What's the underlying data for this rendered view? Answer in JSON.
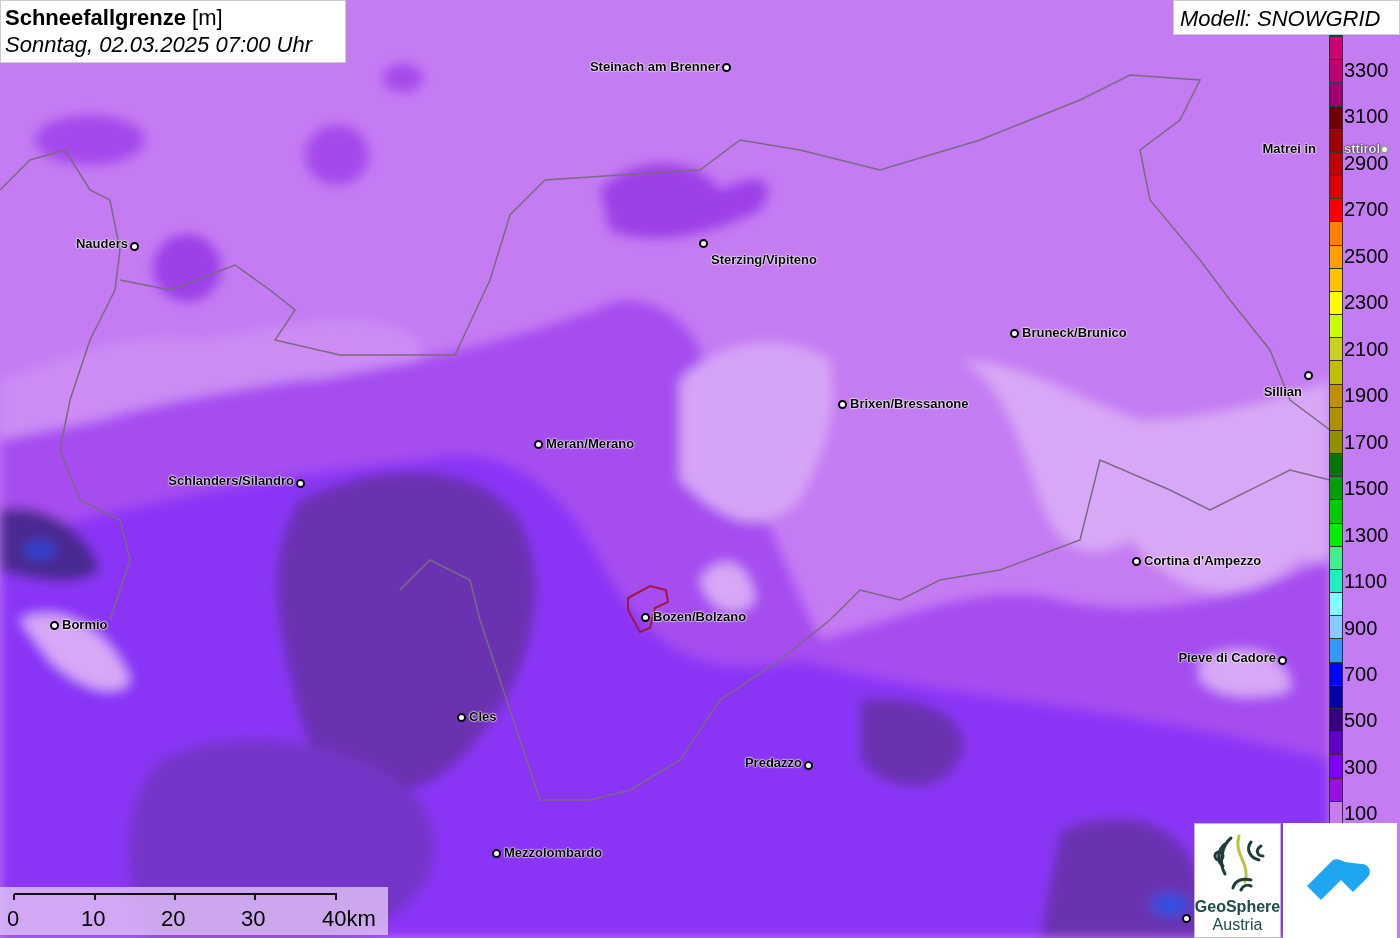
{
  "title": {
    "heading": "**Schneefallgrenze** [m]",
    "subtitle": "Sonntag, 02.03.2025 07:00 Uhr"
  },
  "model": "Modell: SNOWGRID",
  "places": [
    {
      "kind": "town",
      "name": "Steinach am Brenner"
    },
    {
      "kind": "town_partly_hidden",
      "name": "Matrei in",
      "name_continued": "sttirol"
    },
    {
      "kind": "town",
      "name": "Nauders"
    },
    {
      "kind": "town",
      "name": "Sterzing/Vipiteno"
    },
    {
      "kind": "town",
      "name": "Bruneck/Brunico"
    },
    {
      "kind": "town",
      "name": "Sillian"
    },
    {
      "kind": "town",
      "name": "Brixen/Bressanone"
    },
    {
      "kind": "town",
      "name": "Meran/Merano"
    },
    {
      "kind": "town",
      "name": "Schlanders/Silandro"
    },
    {
      "kind": "town",
      "name": "Cortina d'Ampezzo"
    },
    {
      "kind": "town",
      "name": "Bormio"
    },
    {
      "kind": "town",
      "name": "Bozen/Bolzano"
    },
    {
      "kind": "town",
      "name": "Pieve di Cadore"
    },
    {
      "kind": "town",
      "name": "Cles"
    },
    {
      "kind": "town",
      "name": "Predazzo"
    },
    {
      "kind": "town",
      "name": "Mezzolombardo"
    },
    {
      "kind": "marker"
    }
  ],
  "legend": [
    {
      "color": "#d00070"
    },
    {
      "color": "#c00070",
      "label": "3300"
    },
    {
      "color": "#a00070"
    },
    {
      "color": "#700000",
      "label": "3100"
    },
    {
      "color": "#a00000"
    },
    {
      "color": "#c00000",
      "label": "2900"
    },
    {
      "color": "#e00000"
    },
    {
      "color": "#ff0000",
      "label": "2700"
    },
    {
      "color": "#ff8000"
    },
    {
      "color": "#ffa000",
      "label": "2500"
    },
    {
      "color": "#ffc000"
    },
    {
      "color": "#ffff00",
      "label": "2300"
    },
    {
      "color": "#c8ff00"
    },
    {
      "color": "#c8d020",
      "label": "2100"
    },
    {
      "color": "#c0c000"
    },
    {
      "color": "#c09000",
      "label": "1900"
    },
    {
      "color": "#b09000"
    },
    {
      "color": "#909000",
      "label": "1700"
    },
    {
      "color": "#007800"
    },
    {
      "color": "#00a000",
      "label": "1500"
    },
    {
      "color": "#00cc00"
    },
    {
      "color": "#00ee00",
      "label": "1300"
    },
    {
      "color": "#40f090"
    },
    {
      "color": "#20f0c0",
      "label": "1100"
    },
    {
      "color": "#80ffff"
    },
    {
      "color": "#88ccff",
      "label": "900"
    },
    {
      "color": "#3399ff"
    },
    {
      "color": "#0000ff",
      "label": "700"
    },
    {
      "color": "#0000a8"
    },
    {
      "color": "#360080",
      "label": "500"
    },
    {
      "color": "#6000c8"
    },
    {
      "color": "#8000ff",
      "label": "300"
    },
    {
      "color": "#9a10e0"
    },
    {
      "color": "#c77cf0",
      "label": "100"
    }
  ],
  "scale": [
    "0",
    "10",
    "20",
    "30",
    "40km"
  ],
  "logo": {
    "line1": "GeoSphere",
    "line2": "Austria"
  }
}
